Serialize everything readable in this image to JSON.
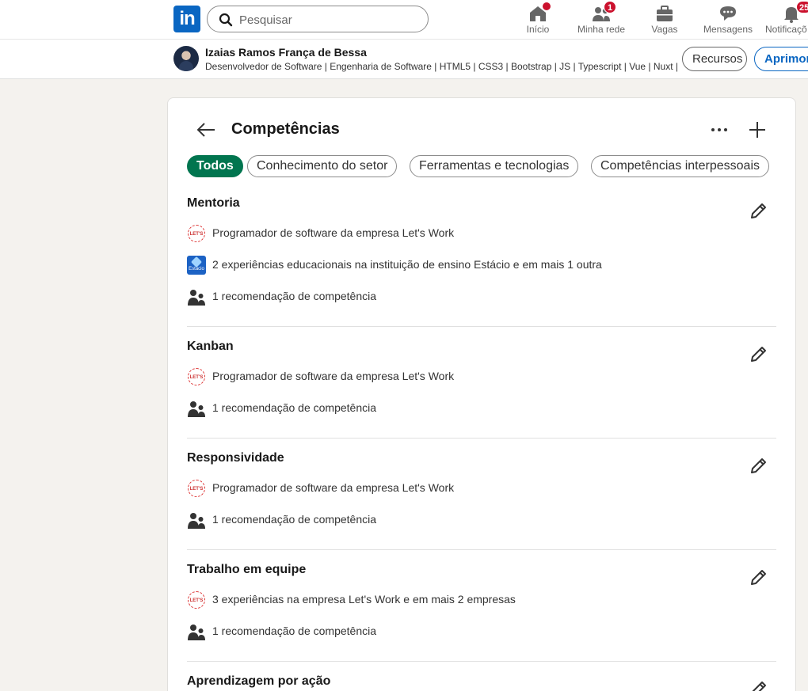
{
  "nav": {
    "logo_text": "in",
    "search_placeholder": "Pesquisar",
    "items": [
      {
        "label": "Início",
        "icon": "home-icon",
        "badge": ""
      },
      {
        "label": "Minha rede",
        "icon": "network-icon",
        "badge": "1"
      },
      {
        "label": "Vagas",
        "icon": "briefcase-icon",
        "badge": ""
      },
      {
        "label": "Mensagens",
        "icon": "messaging-icon",
        "badge": ""
      },
      {
        "label": "Notificaçõ",
        "icon": "bell-icon",
        "badge": "25"
      }
    ]
  },
  "profile": {
    "name": "Izaias Ramos França de Bessa",
    "headline": "Desenvolvedor de Software | Engenharia de Software | HTML5 | CSS3 | Bootstrap | JS | Typescript | Vue | Nuxt | ...",
    "resources_label": "Recursos",
    "improve_label": "Aprimorar"
  },
  "section": {
    "title": "Competências",
    "filters": [
      {
        "label": "Todos",
        "active": true
      },
      {
        "label": "Conhecimento do setor",
        "active": false
      },
      {
        "label": "Ferramentas e tecnologias",
        "active": false
      },
      {
        "label": "Competências interpessoais",
        "active": false
      }
    ]
  },
  "skills": [
    {
      "name": "Mentoria",
      "details": [
        {
          "icon": "letswork-logo",
          "text": "Programador de software da empresa Let's Work"
        },
        {
          "icon": "estacio-logo",
          "text": "2 experiências educacionais na instituição de ensino Estácio e em mais 1 outra"
        },
        {
          "icon": "people-icon",
          "text": "1 recomendação de competência"
        }
      ]
    },
    {
      "name": "Kanban",
      "details": [
        {
          "icon": "letswork-logo",
          "text": "Programador de software da empresa Let's Work"
        },
        {
          "icon": "people-icon",
          "text": "1 recomendação de competência"
        }
      ]
    },
    {
      "name": "Responsividade",
      "details": [
        {
          "icon": "letswork-logo",
          "text": "Programador de software da empresa Let's Work"
        },
        {
          "icon": "people-icon",
          "text": "1 recomendação de competência"
        }
      ]
    },
    {
      "name": "Trabalho em equipe",
      "details": [
        {
          "icon": "letswork-logo",
          "text": "3 experiências na empresa Let's Work e em mais 2 empresas"
        },
        {
          "icon": "people-icon",
          "text": "1 recomendação de competência"
        }
      ]
    },
    {
      "name": "Aprendizagem por ação",
      "details": []
    }
  ],
  "colors": {
    "brand": "#0a66c2",
    "active_filter": "#01754f",
    "badge": "#cb112d"
  }
}
